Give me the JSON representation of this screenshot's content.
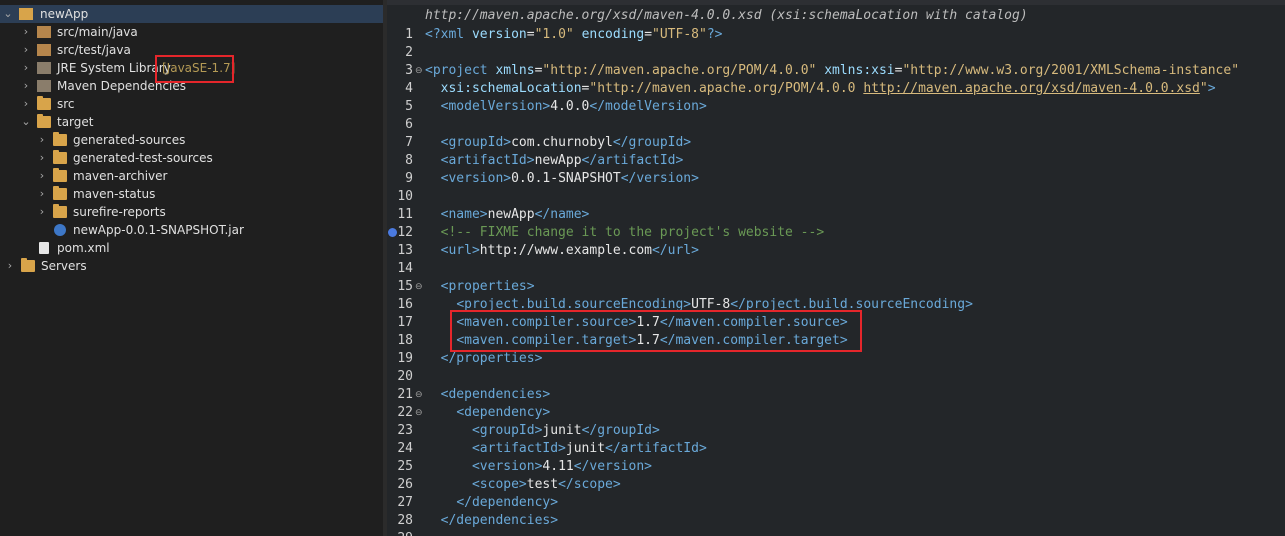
{
  "explorer": {
    "project": "newApp",
    "items": [
      {
        "label": "src/main/java"
      },
      {
        "label": "src/test/java"
      },
      {
        "label": "JRE System Library",
        "decor": "[JavaSE-1.7]"
      },
      {
        "label": "Maven Dependencies"
      },
      {
        "label": "src"
      },
      {
        "label": "target"
      },
      {
        "label": "generated-sources"
      },
      {
        "label": "generated-test-sources"
      },
      {
        "label": "maven-archiver"
      },
      {
        "label": "maven-status"
      },
      {
        "label": "surefire-reports"
      },
      {
        "label": "newApp-0.0.1-SNAPSHOT.jar"
      },
      {
        "label": "pom.xml"
      },
      {
        "label": "Servers"
      }
    ]
  },
  "editor": {
    "header": "http://maven.apache.org/xsd/maven-4.0.0.xsd (xsi:schemaLocation with catalog)",
    "line_numbers": [
      "1",
      "2",
      "3",
      "4",
      "5",
      "6",
      "7",
      "8",
      "9",
      "10",
      "11",
      "12",
      "13",
      "14",
      "15",
      "16",
      "17",
      "18",
      "19",
      "20",
      "21",
      "22",
      "23",
      "24",
      "25",
      "26",
      "27",
      "28",
      "29"
    ],
    "lines": [
      {
        "parts": [
          [
            "t-tag",
            "<?xml "
          ],
          [
            "t-attr",
            "version"
          ],
          [
            "t-text",
            "="
          ],
          [
            "t-str",
            "\"1.0\""
          ],
          [
            "t-text",
            " "
          ],
          [
            "t-attr",
            "encoding"
          ],
          [
            "t-text",
            "="
          ],
          [
            "t-str",
            "\"UTF-8\""
          ],
          [
            "t-tag",
            "?>"
          ]
        ]
      },
      {
        "parts": []
      },
      {
        "parts": [
          [
            "t-tag",
            "<project "
          ],
          [
            "t-attr",
            "xmlns"
          ],
          [
            "t-text",
            "="
          ],
          [
            "t-str",
            "\"http://maven.apache.org/POM/4.0.0\""
          ],
          [
            "t-text",
            " "
          ],
          [
            "t-attr",
            "xmlns:xsi"
          ],
          [
            "t-text",
            "="
          ],
          [
            "t-str",
            "\"http://www.w3.org/2001/XMLSchema-instance\""
          ]
        ]
      },
      {
        "parts": [
          [
            "t-text",
            "  "
          ],
          [
            "t-attr",
            "xsi:schemaLocation"
          ],
          [
            "t-text",
            "="
          ],
          [
            "t-str",
            "\"http://maven.apache.org/POM/4.0.0 "
          ],
          [
            "t-link",
            "http://maven.apache.org/xsd/maven-4.0.0.xsd"
          ],
          [
            "t-str",
            "\""
          ],
          [
            "t-tag",
            ">"
          ]
        ]
      },
      {
        "parts": [
          [
            "t-text",
            "  "
          ],
          [
            "t-tag",
            "<modelVersion>"
          ],
          [
            "t-text",
            "4.0.0"
          ],
          [
            "t-tag",
            "</modelVersion>"
          ]
        ]
      },
      {
        "parts": []
      },
      {
        "parts": [
          [
            "t-text",
            "  "
          ],
          [
            "t-tag",
            "<groupId>"
          ],
          [
            "t-text",
            "com.churnobyl"
          ],
          [
            "t-tag",
            "</groupId>"
          ]
        ]
      },
      {
        "parts": [
          [
            "t-text",
            "  "
          ],
          [
            "t-tag",
            "<artifactId>"
          ],
          [
            "t-text",
            "newApp"
          ],
          [
            "t-tag",
            "</artifactId>"
          ]
        ]
      },
      {
        "parts": [
          [
            "t-text",
            "  "
          ],
          [
            "t-tag",
            "<version>"
          ],
          [
            "t-text",
            "0.0.1-SNAPSHOT"
          ],
          [
            "t-tag",
            "</version>"
          ]
        ]
      },
      {
        "parts": []
      },
      {
        "parts": [
          [
            "t-text",
            "  "
          ],
          [
            "t-tag",
            "<name>"
          ],
          [
            "t-text",
            "newApp"
          ],
          [
            "t-tag",
            "</name>"
          ]
        ]
      },
      {
        "parts": [
          [
            "t-text",
            "  "
          ],
          [
            "t-cmt",
            "<!-- FIXME change it to the project's website -->"
          ]
        ]
      },
      {
        "parts": [
          [
            "t-text",
            "  "
          ],
          [
            "t-tag",
            "<url>"
          ],
          [
            "t-text",
            "http://www.example.com"
          ],
          [
            "t-tag",
            "</url>"
          ]
        ]
      },
      {
        "parts": []
      },
      {
        "parts": [
          [
            "t-text",
            "  "
          ],
          [
            "t-tag",
            "<properties>"
          ]
        ]
      },
      {
        "parts": [
          [
            "t-text",
            "    "
          ],
          [
            "t-tag",
            "<project.build.sourceEncoding>"
          ],
          [
            "t-text",
            "UTF-8"
          ],
          [
            "t-tag",
            "</project.build.sourceEncoding>"
          ]
        ]
      },
      {
        "parts": [
          [
            "t-text",
            "    "
          ],
          [
            "t-tag",
            "<maven.compiler.source>"
          ],
          [
            "t-text",
            "1.7"
          ],
          [
            "t-tag",
            "</maven.compiler.source>"
          ]
        ]
      },
      {
        "parts": [
          [
            "t-text",
            "    "
          ],
          [
            "t-tag",
            "<maven.compiler.target>"
          ],
          [
            "t-text",
            "1.7"
          ],
          [
            "t-tag",
            "</maven.compiler.target>"
          ]
        ]
      },
      {
        "parts": [
          [
            "t-text",
            "  "
          ],
          [
            "t-tag",
            "</properties>"
          ]
        ]
      },
      {
        "parts": []
      },
      {
        "parts": [
          [
            "t-text",
            "  "
          ],
          [
            "t-tag",
            "<dependencies>"
          ]
        ]
      },
      {
        "parts": [
          [
            "t-text",
            "    "
          ],
          [
            "t-tag",
            "<dependency>"
          ]
        ]
      },
      {
        "parts": [
          [
            "t-text",
            "      "
          ],
          [
            "t-tag",
            "<groupId>"
          ],
          [
            "t-text",
            "junit"
          ],
          [
            "t-tag",
            "</groupId>"
          ]
        ]
      },
      {
        "parts": [
          [
            "t-text",
            "      "
          ],
          [
            "t-tag",
            "<artifactId>"
          ],
          [
            "t-text",
            "junit"
          ],
          [
            "t-tag",
            "</artifactId>"
          ]
        ]
      },
      {
        "parts": [
          [
            "t-text",
            "      "
          ],
          [
            "t-tag",
            "<version>"
          ],
          [
            "t-text",
            "4.11"
          ],
          [
            "t-tag",
            "</version>"
          ]
        ]
      },
      {
        "parts": [
          [
            "t-text",
            "      "
          ],
          [
            "t-tag",
            "<scope>"
          ],
          [
            "t-text",
            "test"
          ],
          [
            "t-tag",
            "</scope>"
          ]
        ]
      },
      {
        "parts": [
          [
            "t-text",
            "    "
          ],
          [
            "t-tag",
            "</dependency>"
          ]
        ]
      },
      {
        "parts": [
          [
            "t-text",
            "  "
          ],
          [
            "t-tag",
            "</dependencies>"
          ]
        ]
      },
      {
        "parts": []
      }
    ]
  },
  "colors": {
    "highlight_box": "#e5262b",
    "tag": "#6aa9d9",
    "string": "#d7ba7d",
    "comment": "#6a9955"
  }
}
